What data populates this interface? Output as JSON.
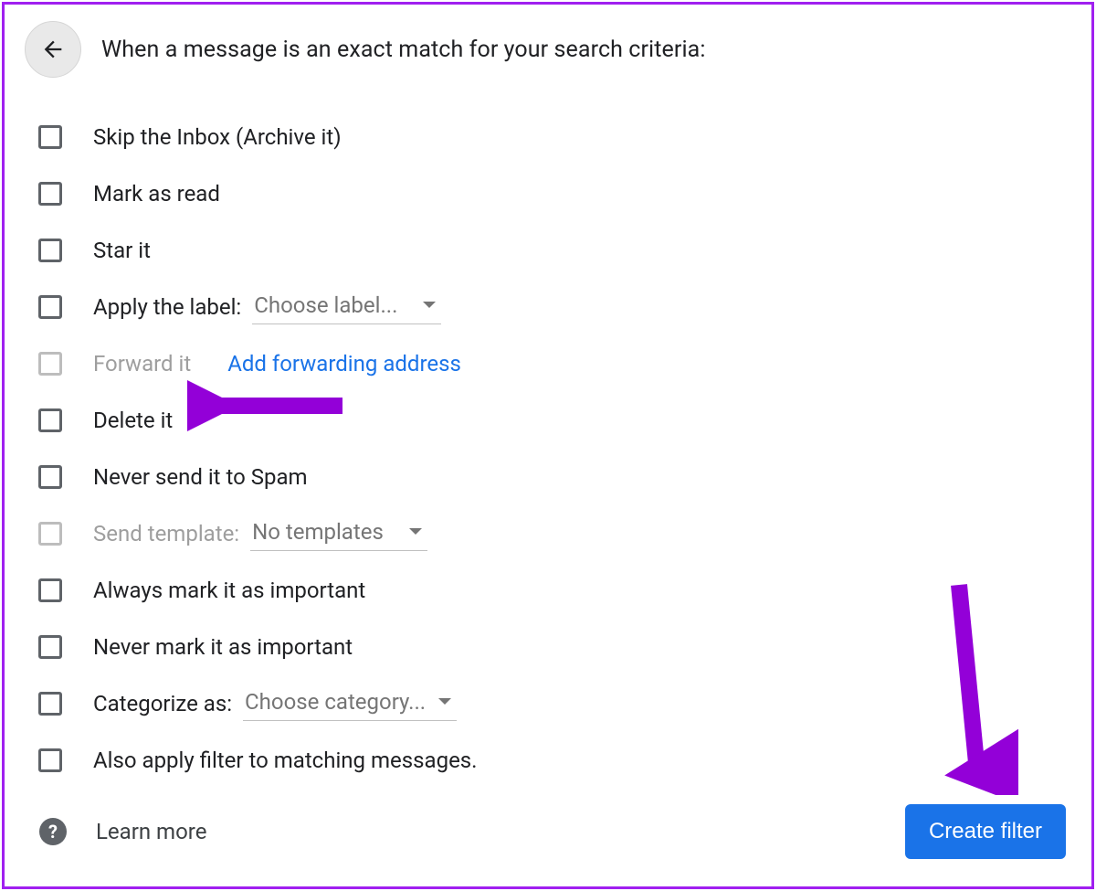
{
  "header": {
    "title": "When a message is an exact match for your search criteria:"
  },
  "options": {
    "skip_inbox": "Skip the Inbox (Archive it)",
    "mark_read": "Mark as read",
    "star_it": "Star it",
    "apply_label": "Apply the label:",
    "apply_label_dropdown": "Choose label...",
    "forward_it": "Forward it",
    "forward_link": "Add forwarding address",
    "delete_it": "Delete it",
    "never_spam": "Never send it to Spam",
    "send_template": "Send template:",
    "send_template_dropdown": "No templates",
    "always_important": "Always mark it as important",
    "never_important": "Never mark it as important",
    "categorize_as": "Categorize as:",
    "categorize_dropdown": "Choose category...",
    "also_apply": "Also apply filter to matching messages."
  },
  "footer": {
    "learn_more": "Learn more",
    "create_button": "Create filter"
  }
}
